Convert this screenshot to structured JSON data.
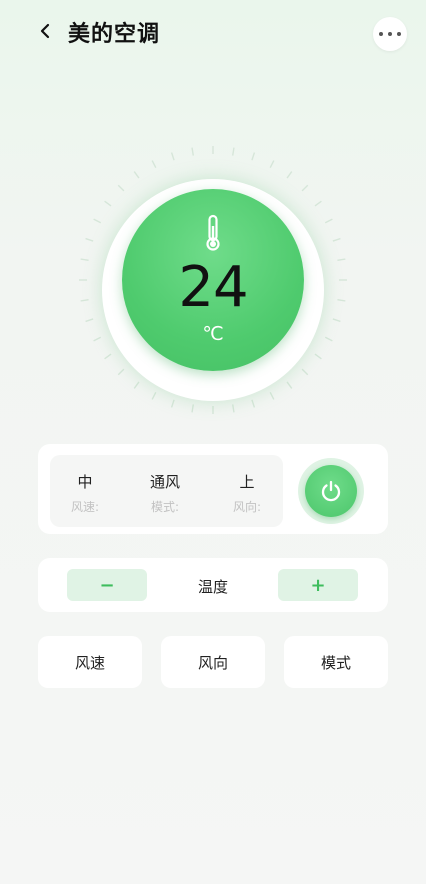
{
  "header": {
    "title": "美的空调",
    "back_icon": "chevron-left-icon",
    "more_icon": "more-horizontal-icon"
  },
  "dial": {
    "temperature": "24",
    "unit": "℃",
    "icon": "thermometer-icon"
  },
  "status": {
    "items": [
      {
        "value": "中",
        "label": "风速:"
      },
      {
        "value": "通风",
        "label": "模式:"
      },
      {
        "value": "上",
        "label": "风向:"
      }
    ],
    "power_icon": "power-icon"
  },
  "temperature_control": {
    "minus": "−",
    "label": "温度",
    "plus": "+"
  },
  "buttons": [
    "风速",
    "风向",
    "模式"
  ],
  "colors": {
    "accent": "#4fcb6e",
    "accent_light": "#e0f3e5"
  }
}
